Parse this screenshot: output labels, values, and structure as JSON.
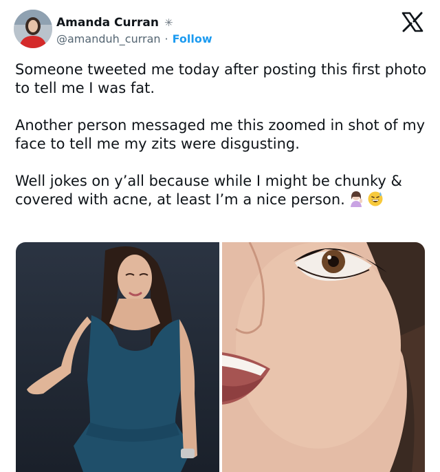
{
  "author": {
    "name": "Amanda Curran",
    "handle": "@amanduh_curran",
    "separator": "·",
    "follow_label": "Follow",
    "verified_icon": "✳"
  },
  "tweet": {
    "paragraphs": [
      "Someone tweeted me today after posting this first photo to tell me I was fat.",
      "Another person messaged me this zoomed in shot of my face to tell me my zits were disgusting.",
      "Well jokes on y’all because while I might be chunky & covered with acne, at least I’m a nice person."
    ],
    "emojis": [
      "woman-tipping-hand-icon",
      "grinning-sweat-icon"
    ]
  },
  "icons": {
    "platform": "x-logo-icon"
  },
  "colors": {
    "follow": "#1d9bf0",
    "handle": "#536471",
    "text": "#0f1419"
  }
}
